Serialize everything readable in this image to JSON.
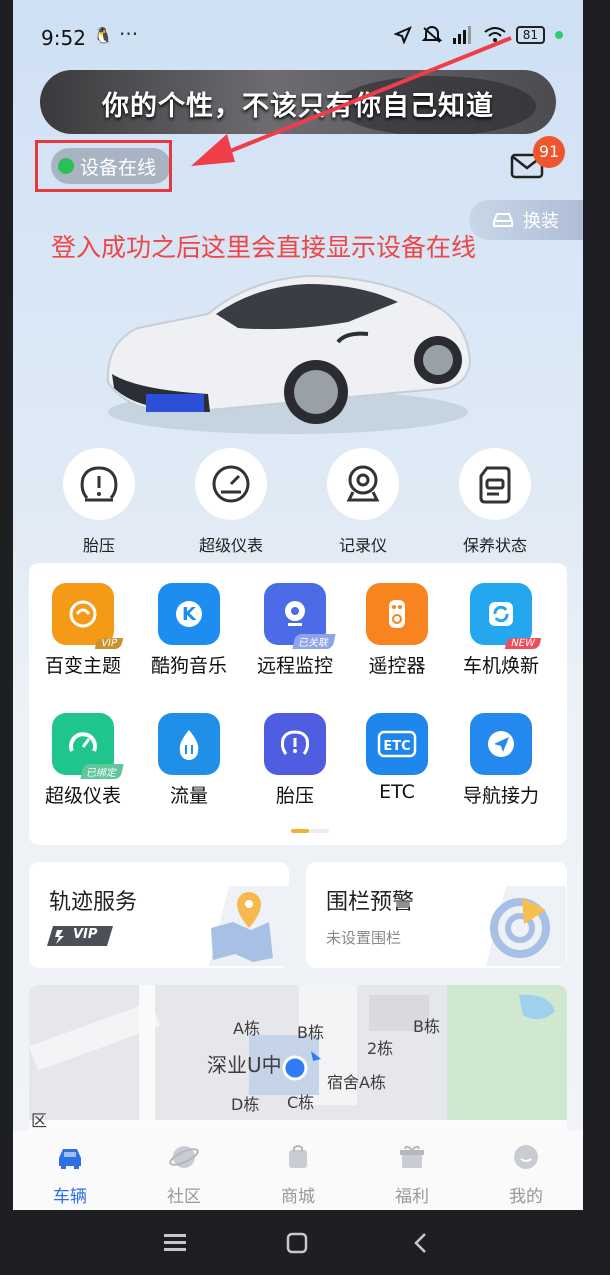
{
  "status": {
    "time": "9:52",
    "battery": "81",
    "dots": "···"
  },
  "banner": {
    "text": "你的个性，不该只有你自己知道"
  },
  "device": {
    "status_label": "设备在线"
  },
  "mail": {
    "badge": "91"
  },
  "change_button": {
    "label": "换装"
  },
  "annotation": "登入成功之后这里会直接显示设备在线",
  "quick_actions": [
    {
      "label": "胎压",
      "icon": "tire-pressure-icon"
    },
    {
      "label": "超级仪表",
      "icon": "gauge-icon"
    },
    {
      "label": "记录仪",
      "icon": "dashcam-icon"
    },
    {
      "label": "保养状态",
      "icon": "maintenance-icon"
    }
  ],
  "apps": [
    {
      "label": "百变主题",
      "icon": "theme-icon",
      "tag": "VIP",
      "color": "#f59a17"
    },
    {
      "label": "酷狗音乐",
      "icon": "kugou-icon",
      "tag": "",
      "color": "#1d8ef0"
    },
    {
      "label": "远程监控",
      "icon": "camera-icon",
      "tag": "已关联",
      "color": "#4b6ce6"
    },
    {
      "label": "遥控器",
      "icon": "remote-icon",
      "tag": "",
      "color": "#f7841f"
    },
    {
      "label": "车机焕新",
      "icon": "refresh-icon",
      "tag": "NEW",
      "color": "#25a7ef"
    },
    {
      "label": "超级仪表",
      "icon": "speedometer-icon",
      "tag": "已绑定",
      "color": "#20c48d"
    },
    {
      "label": "流量",
      "icon": "data-flow-icon",
      "tag": "",
      "color": "#1f8fe8"
    },
    {
      "label": "胎压",
      "icon": "tire-icon",
      "tag": "",
      "color": "#4f5de0"
    },
    {
      "label": "ETC",
      "icon": "etc-icon",
      "tag": "",
      "color": "#1f86ee"
    },
    {
      "label": "导航接力",
      "icon": "navigation-icon",
      "tag": "",
      "color": "#2489ef"
    }
  ],
  "more_glyph": "⋮",
  "cards": {
    "track": {
      "title": "轨迹服务",
      "badge": "VIP"
    },
    "fence": {
      "title": "围栏预警",
      "subtitle": "未设置围栏"
    }
  },
  "map": {
    "labels": [
      "A栋",
      "B栋",
      "B栋",
      "2栋",
      "深业U中",
      "宿舍A栋",
      "D栋",
      "C栋",
      "区"
    ]
  },
  "tabs": [
    {
      "label": "车辆",
      "icon": "car-icon",
      "active": true
    },
    {
      "label": "社区",
      "icon": "planet-icon",
      "active": false
    },
    {
      "label": "商城",
      "icon": "shopping-bag-icon",
      "active": false
    },
    {
      "label": "福利",
      "icon": "gift-icon",
      "active": false
    },
    {
      "label": "我的",
      "icon": "profile-icon",
      "active": false
    }
  ],
  "colors": {
    "accent": "#2f6fe4",
    "online": "#2bbf57",
    "annotation": "#f04545"
  }
}
